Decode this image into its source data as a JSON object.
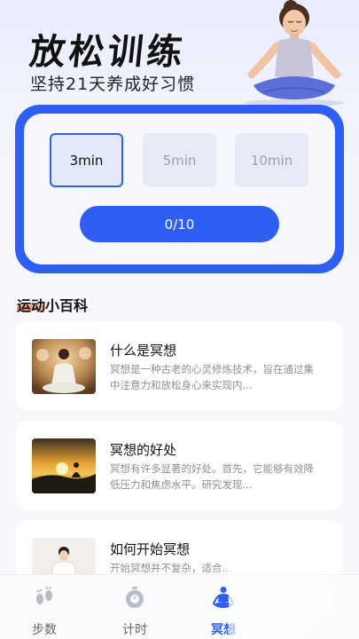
{
  "header": {
    "title": "放松训练",
    "subtitle": "坚持21天养成好习惯"
  },
  "durations": [
    {
      "label": "3min",
      "selected": true
    },
    {
      "label": "5min",
      "selected": false
    },
    {
      "label": "10min",
      "selected": false
    }
  ],
  "progress": {
    "label": "0/10",
    "done": 0,
    "total": 10
  },
  "section": {
    "title": "运动小百科"
  },
  "articles": [
    {
      "title": "什么是冥想",
      "desc": "冥想是一种古老的心灵修炼技术，旨在通过集中注意力和放松身心来实现内..."
    },
    {
      "title": "冥想的好处",
      "desc": "冥想有许多显著的好处。首先，它能够有效降低压力和焦虑水平。研究发现..."
    },
    {
      "title": "如何开始冥想",
      "desc": "开始冥想并不复杂，适合..."
    }
  ],
  "tabs": [
    {
      "label": "步数",
      "icon": "footprints-icon",
      "active": false
    },
    {
      "label": "计时",
      "icon": "stopwatch-icon",
      "active": false
    },
    {
      "label": "冥想",
      "icon": "meditation-icon",
      "active": true
    }
  ],
  "colors": {
    "accent": "#2e5ef2",
    "highlight": "#ff7a3c"
  }
}
